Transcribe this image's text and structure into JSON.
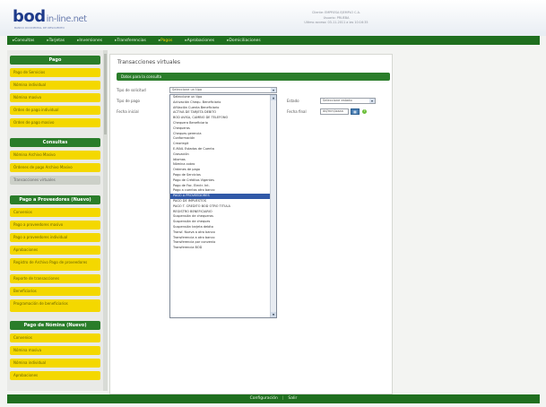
{
  "brand": {
    "logo": "bod",
    "logo_suffix": "in-line.net",
    "tagline": "BANCO OCCIDENTAL DE DESCUENTO"
  },
  "user_info": [
    "Cliente: EMPRESA EJEMPLO C.A.",
    "Usuario: PRUEBA",
    "Ultimo acceso: 03-11-2011 a las 10:16:35"
  ],
  "main_menu": [
    {
      "label": "Consultas",
      "active": false
    },
    {
      "label": "Tarjetas",
      "active": false
    },
    {
      "label": "Inversiones",
      "active": false
    },
    {
      "label": "Transferencias",
      "active": false
    },
    {
      "label": "Pagos",
      "active": true
    },
    {
      "label": "Aprobaciones",
      "active": false
    },
    {
      "label": "Domiciliaciones",
      "active": false
    }
  ],
  "sidebar": {
    "sections": [
      {
        "title": "Pago",
        "items": [
          "Pago de Servicios",
          "Nómina individual",
          "Nómina masivo",
          "Orden de pago individual",
          "Orden de pago masivo"
        ]
      },
      {
        "title": "Consultas",
        "items": [
          "Nómina Archivo Masivo",
          "Órdenes de pago Archivo Masivo",
          "Transacciones virtuales"
        ]
      },
      {
        "title": "Pago a Proveedores (Nuevo)",
        "items": [
          "Convenios",
          "Pago a proveedores masivo",
          "Pago a proveedores individual",
          "Aprobaciones",
          "Registro de Archivo Pago de proveedores",
          "Reporte de transacciones",
          "Beneficiarios",
          "Programación de beneficiarios"
        ]
      },
      {
        "title": "Pago de Nómina (Nuevo)",
        "items": [
          "Convenios",
          "Nómina masiva",
          "Nómina individual",
          "Aprobaciones"
        ]
      }
    ],
    "selected_item": "Transacciones virtuales"
  },
  "content": {
    "title": "Transacciones virtuales",
    "subheader": "Datos para la consulta",
    "labels": {
      "tipo_solicitud": "Tipo de solicitud",
      "tipo_pago": "Tipo de pago",
      "fecha_inicial": "Fecha inicial",
      "estado": "Estado",
      "fecha_final": "Fecha final"
    },
    "tipo_solicitud_value": "Seleccione un tipo",
    "estado_value": "Seleccione estado",
    "fecha_final_value": "dd/mm/aaaa",
    "options": [
      "Seleccione un tipo",
      "Activación Chequ. Beneficiario",
      "Afiliación Cuenta Beneficiario",
      "ACTIVA DE TARJETA DEBITO",
      "BOD AVISA, CAMBIO DE TELEFONO",
      "Chequera Beneficiario",
      "Chequeras",
      "Cheques gerencia",
      "Conformación",
      "Crearlegit",
      "E-MAIL Estados de Cuenta",
      "Gravación",
      "Idiomas",
      "Nómina cobro",
      "Órdenes de pago",
      "Pago de Servicios",
      "Pago de Créditos Vigentes",
      "Pago de Fac. Electr. Int.",
      "Pago a cuentas otro banco",
      "PAGO A PROVEEDORES",
      "PAGO DE IMPUESTOS",
      "PAGO T. CREDITO BOD OTRO TITULA",
      "REGISTRO BENEFICIARIO",
      "Suspensión de chequeras",
      "Suspensión de cheques",
      "Suspensión tarjeta debito",
      "Transf. Nueva a otro banco",
      "Transferencia a otro banco",
      "Transferencia por convenio",
      "Transferencia BOD"
    ],
    "highlighted_option": "PAGO A PROVEEDORES"
  },
  "footer": {
    "link1": "Configuración",
    "link2": "Salir"
  }
}
